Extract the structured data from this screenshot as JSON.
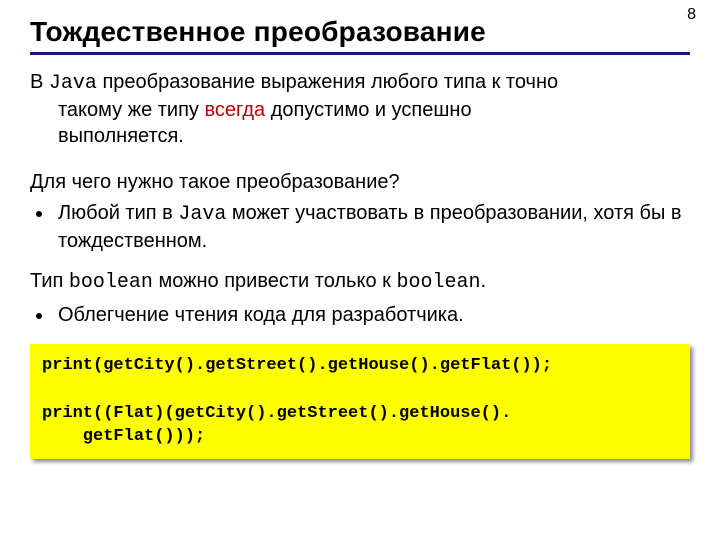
{
  "page_number": "8",
  "title": "Тождественное преобразование",
  "intro": {
    "prefix": "В ",
    "java": "Java",
    "after_java": " преобразование выражения любого типа к точно",
    "cont1_a": "такому же типу ",
    "cont1_hl": "всегда",
    "cont1_b": " допустимо и успешно",
    "cont2": "выполняется."
  },
  "question": "Для чего нужно такое преобразование?",
  "bullets1": {
    "b1_a": "Любой тип в ",
    "b1_java": "Java",
    "b1_b": " может участвовать в преобразовании, хотя бы в тождественном."
  },
  "stmt": {
    "a": "Тип ",
    "b": "boolean",
    "c": " можно привести только к ",
    "d": "boolean",
    "e": "."
  },
  "bullets2": {
    "b1": "Облегчение чтения кода для разработчика."
  },
  "code": "print(getCity().getStreet().getHouse().getFlat());\n\nprint((Flat)(getCity().getStreet().getHouse().\n    getFlat()));"
}
